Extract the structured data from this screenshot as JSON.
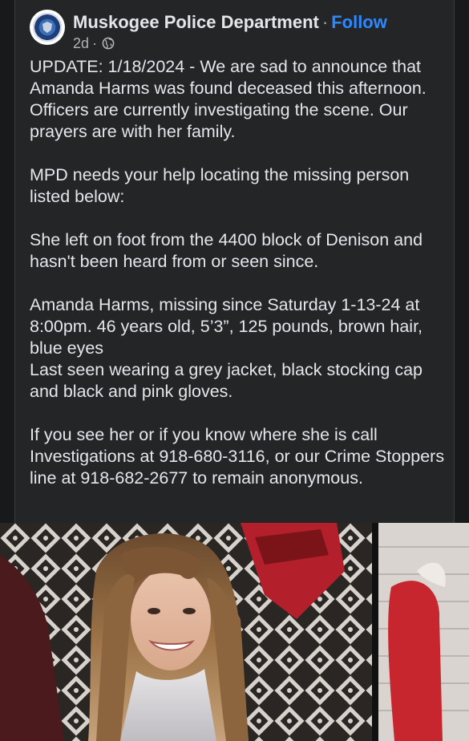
{
  "post": {
    "page_name": "Muskogee Police Department",
    "separator": "·",
    "follow_label": "Follow",
    "timestamp": "2d",
    "meta_separator": "·",
    "privacy_icon": "globe-icon",
    "body_text": "UPDATE: 1/18/2024 - We are sad to announce that Amanda Harms was found deceased this afternoon. Officers are currently investigating the scene. Our prayers are with her family.\n\nMPD needs your help locating the missing person listed below:\n\nShe left on foot from the 4400 block of Denison and hasn't been heard from or seen since.\n\nAmanda Harms, missing since Saturday 1-13-24 at 8:00pm. 46 years old, 5’3”, 125 pounds, brown hair, blue eyes\nLast seen wearing a grey jacket, black stocking cap and black and pink gloves.\n\nIf you see her or if you know where she is call Investigations at 918-680-3116, or our Crime Stoppers line at 918-682-2677 to remain anonymous."
  },
  "colors": {
    "background": "#18191a",
    "card": "#242526",
    "text_primary": "#e4e6eb",
    "text_secondary": "#b0b3b8",
    "link": "#2d88ff"
  }
}
